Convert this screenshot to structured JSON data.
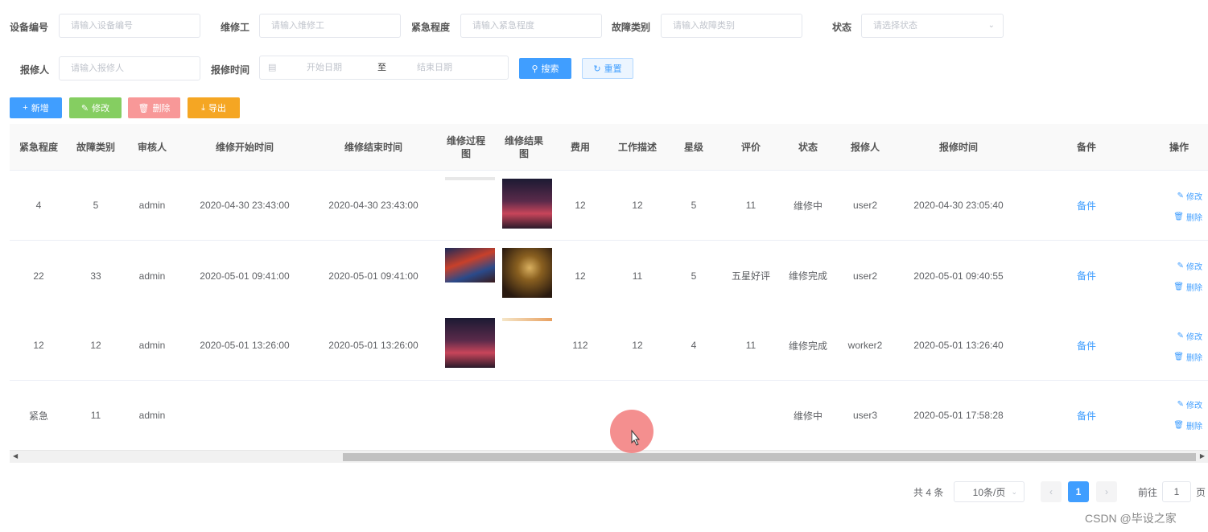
{
  "filters": {
    "device_label": "设备编号",
    "device_ph": "请输入设备编号",
    "repairer_label": "维修工",
    "repairer_ph": "请输入维修工",
    "urgency_label": "紧急程度",
    "urgency_ph": "请输入紧急程度",
    "fault_label": "故障类别",
    "fault_ph": "请输入故障类别",
    "status_label": "状态",
    "status_ph": "请选择状态",
    "reporter_label": "报修人",
    "reporter_ph": "请输入报修人",
    "time_label": "报修时间",
    "start_ph": "开始日期",
    "range_sep": "至",
    "end_ph": "结束日期",
    "search_btn": "搜索",
    "reset_btn": "重置"
  },
  "toolbar": {
    "add": "新增",
    "edit": "修改",
    "delete": "删除",
    "export": "导出"
  },
  "columns": [
    "紧急程度",
    "故障类别",
    "审核人",
    "维修开始时间",
    "维修结束时间",
    "维修过程图",
    "维修结果图",
    "费用",
    "工作描述",
    "星级",
    "评价",
    "状态",
    "报修人",
    "报修时间",
    "备件",
    "操作"
  ],
  "rows": [
    {
      "urgency": "4",
      "fault": "5",
      "auditor": "admin",
      "start": "2020-04-30 23:43:00",
      "end": "2020-04-30 23:43:00",
      "cost": "12",
      "desc": "12",
      "stars": "5",
      "review": "11",
      "status": "维修中",
      "reporter": "user2",
      "time": "2020-04-30 23:05:40",
      "parts": "备件",
      "edit": "修改",
      "del": "删除"
    },
    {
      "urgency": "22",
      "fault": "33",
      "auditor": "admin",
      "start": "2020-05-01 09:41:00",
      "end": "2020-05-01 09:41:00",
      "cost": "12",
      "desc": "11",
      "stars": "5",
      "review": "五星好评",
      "status": "维修完成",
      "reporter": "user2",
      "time": "2020-05-01 09:40:55",
      "parts": "备件",
      "edit": "修改",
      "del": "删除"
    },
    {
      "urgency": "12",
      "fault": "12",
      "auditor": "admin",
      "start": "2020-05-01 13:26:00",
      "end": "2020-05-01 13:26:00",
      "cost": "112",
      "desc": "12",
      "stars": "4",
      "review": "11",
      "status": "维修完成",
      "reporter": "worker2",
      "time": "2020-05-01 13:26:40",
      "parts": "备件",
      "edit": "修改",
      "del": "删除"
    },
    {
      "urgency": "紧急",
      "fault": "11",
      "auditor": "admin",
      "start": "",
      "end": "",
      "cost": "",
      "desc": "",
      "stars": "",
      "review": "",
      "status": "维修中",
      "reporter": "user3",
      "time": "2020-05-01 17:58:28",
      "parts": "备件",
      "edit": "修改",
      "del": "删除"
    }
  ],
  "pagination": {
    "total": "共 4 条",
    "page_size": "10条/页",
    "current": "1",
    "goto_label": "前往",
    "goto_value": "1",
    "page_suffix": "页"
  },
  "watermark": "CSDN @毕设之家",
  "colors": {
    "primary": "#409eff",
    "success": "#85ce61",
    "danger": "#f89898",
    "warning": "#f5a623"
  }
}
